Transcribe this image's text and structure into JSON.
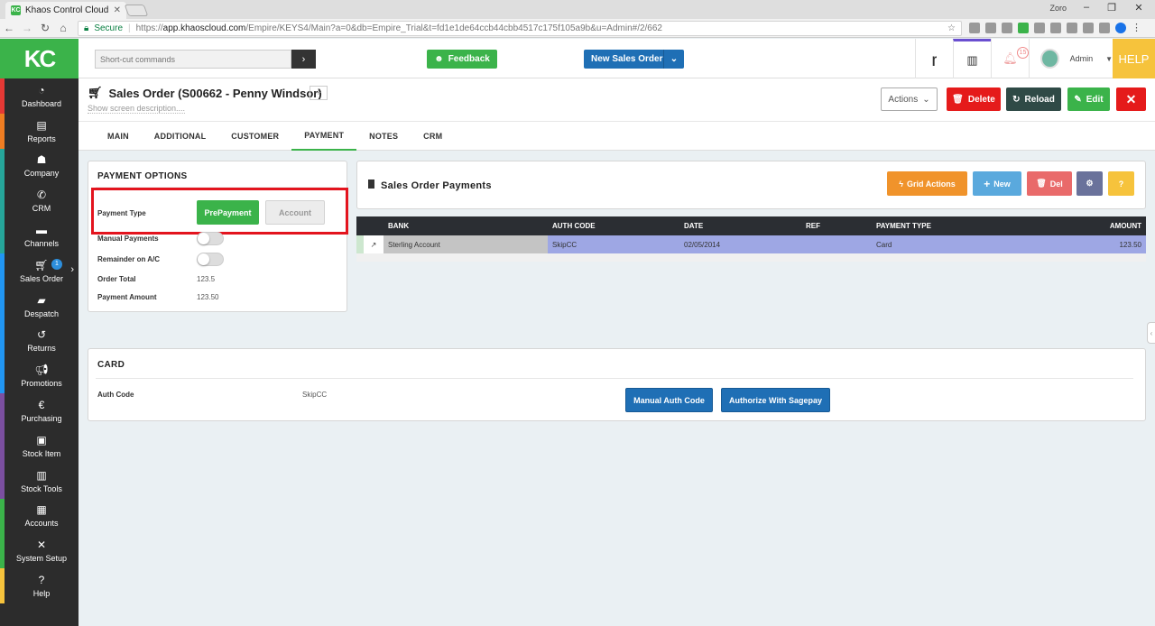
{
  "browser": {
    "tab_title": "Khaos Control Cloud",
    "favicon_text": "KC",
    "user": "Zoro",
    "secure_label": "Secure",
    "url_scheme": "https://",
    "url_host": "app.khaoscloud.com",
    "url_path": "/Empire/KEYS4/Main?a=0&db=Empire_Trial&t=fd1e1de64ccb44cbb4517c175f105a9b&u=Admin#/2/662"
  },
  "logo": "KC",
  "sidebar": {
    "items": [
      {
        "label": "Dashboard",
        "icon": "dashboard-icon",
        "color": "#e53935"
      },
      {
        "label": "Reports",
        "icon": "file-icon",
        "color": "#ef7d22"
      },
      {
        "label": "Company",
        "icon": "users-icon",
        "color": "#26a69a"
      },
      {
        "label": "CRM",
        "icon": "phone-icon",
        "color": "#26a69a"
      },
      {
        "label": "Channels",
        "icon": "server-icon",
        "color": "#26a69a"
      },
      {
        "label": "Sales Order",
        "icon": "cart-icon",
        "color": "#2196f3",
        "badge": "1"
      },
      {
        "label": "Despatch",
        "icon": "truck-icon",
        "color": "#2196f3"
      },
      {
        "label": "Returns",
        "icon": "returns-icon",
        "color": "#2196f3"
      },
      {
        "label": "Promotions",
        "icon": "megaphone-icon",
        "color": "#2196f3"
      },
      {
        "label": "Purchasing",
        "icon": "currency-icon",
        "color": "#7b4fa0"
      },
      {
        "label": "Stock Item",
        "icon": "box-icon",
        "color": "#7b4fa0"
      },
      {
        "label": "Stock Tools",
        "icon": "chart-icon",
        "color": "#7b4fa0"
      },
      {
        "label": "Accounts",
        "icon": "ledger-icon",
        "color": "#3bb34a"
      },
      {
        "label": "System Setup",
        "icon": "tools-icon",
        "color": "#3bb34a"
      },
      {
        "label": "Help",
        "icon": "question-icon",
        "color": "#f6c33c"
      }
    ]
  },
  "header": {
    "shortcut_placeholder": "Short-cut commands",
    "feedback_label": "Feedback",
    "new_sales_order_label": "New Sales Order",
    "notification_count": "15",
    "admin_name": "Admin",
    "help_label": "HELP"
  },
  "titlebar": {
    "title": "Sales Order (S00662 - Penny Windsor)",
    "show_description": "Show screen description....",
    "actions_label": "Actions",
    "delete_label": "Delete",
    "reload_label": "Reload",
    "edit_label": "Edit"
  },
  "tabs": [
    {
      "label": "MAIN"
    },
    {
      "label": "ADDITIONAL"
    },
    {
      "label": "CUSTOMER"
    },
    {
      "label": "PAYMENT",
      "active": true
    },
    {
      "label": "NOTES"
    },
    {
      "label": "CRM"
    }
  ],
  "payment_options": {
    "title": "PAYMENT OPTIONS",
    "payment_type_label": "Payment Type",
    "prepayment_label": "PrePayment",
    "account_label": "Account",
    "manual_payments_label": "Manual Payments",
    "remainder_label": "Remainder on A/C",
    "order_total_label": "Order Total",
    "order_total_value": "123.5",
    "payment_amount_label": "Payment Amount",
    "payment_amount_value": "123.50"
  },
  "sales_order_payments": {
    "title": "Sales Order Payments",
    "grid_actions_label": "Grid Actions",
    "new_label": "New",
    "del_label": "Del",
    "help_label": "?",
    "columns": [
      "BANK",
      "AUTH CODE",
      "DATE",
      "REF",
      "PAYMENT TYPE",
      "AMOUNT"
    ],
    "rows": [
      {
        "bank": "Sterling Account",
        "auth_code": "SkipCC",
        "date": "02/05/2014",
        "ref": "",
        "payment_type": "Card",
        "amount": "123.50"
      }
    ]
  },
  "card": {
    "title": "CARD",
    "auth_code_label": "Auth Code",
    "auth_code_value": "SkipCC",
    "manual_auth_label": "Manual Auth Code",
    "sagepay_label": "Authorize With Sagepay"
  }
}
